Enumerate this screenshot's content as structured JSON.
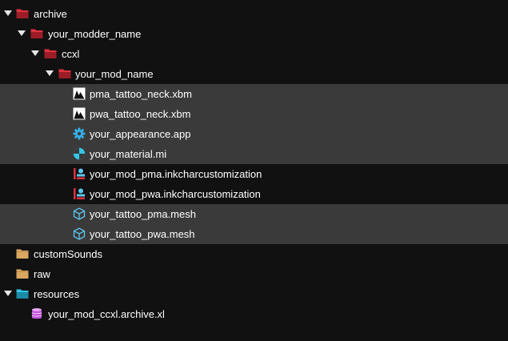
{
  "tree": {
    "archive": "archive",
    "modder": "your_modder_name",
    "ccxl": "ccxl",
    "mod_name": "your_mod_name",
    "files": [
      "pma_tattoo_neck.xbm",
      "pwa_tattoo_neck.xbm",
      "your_appearance.app",
      "your_material.mi",
      "your_mod_pma.inkcharcustomization",
      "your_mod_pwa.inkcharcustomization",
      "your_tattoo_pma.mesh",
      "your_tattoo_pwa.mesh"
    ],
    "custom_sounds": "customSounds",
    "raw": "raw",
    "resources": "resources",
    "archive_xl": "your_mod_ccxl.archive.xl"
  },
  "colors": {
    "background": "#111111",
    "selected_row": "#3a3a3a",
    "folder_red": "#e0313f",
    "folder_tan": "#d9a75f",
    "folder_cyan": "#34c6e8",
    "appearance_icon": "#35aee6",
    "mesh_icon": "#5cc8ee",
    "archivexl_icon": "#c14fd9"
  },
  "icons": {
    "archive": "folder-open-red-icon",
    "modder": "folder-open-red-icon",
    "ccxl": "folder-open-red-icon",
    "mod_name": "folder-open-red-icon",
    "xbm": "texture-image-icon",
    "app": "gear-icon",
    "mi": "material-icon",
    "inkchar": "character-customization-icon",
    "mesh": "cube-icon",
    "custom_sounds": "folder-tan-icon",
    "raw": "folder-tan-icon",
    "resources": "folder-open-cyan-icon",
    "archive_xl": "database-icon"
  }
}
